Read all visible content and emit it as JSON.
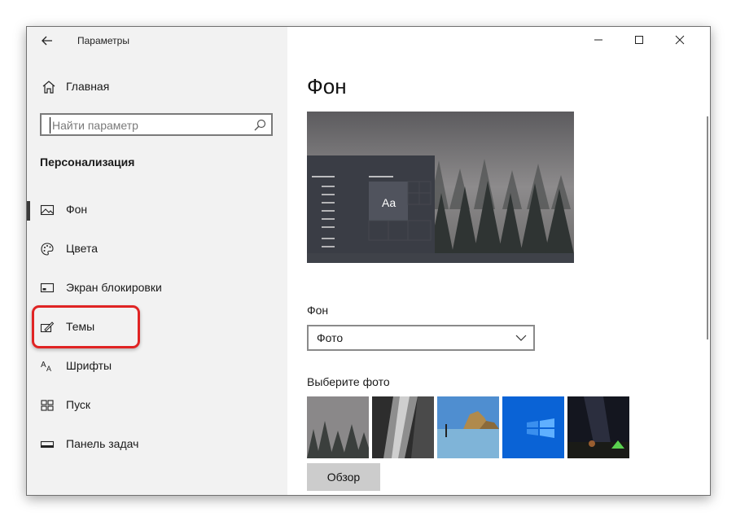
{
  "window": {
    "title": "Параметры",
    "back_icon": "arrow-left-icon",
    "controls": [
      "minimize-icon",
      "maximize-icon",
      "close-icon"
    ]
  },
  "sidebar": {
    "home": {
      "label": "Главная",
      "icon": "home-icon"
    },
    "search": {
      "placeholder": "Найти параметр",
      "value": "",
      "icon": "search-icon"
    },
    "section_title": "Персонализация",
    "items": [
      {
        "label": "Фон",
        "icon": "picture-icon",
        "selected": true
      },
      {
        "label": "Цвета",
        "icon": "palette-icon",
        "selected": false
      },
      {
        "label": "Экран блокировки",
        "icon": "monitor-icon",
        "selected": false
      },
      {
        "label": "Темы",
        "icon": "themes-brush-icon",
        "selected": false,
        "highlighted": true
      },
      {
        "label": "Шрифты",
        "icon": "font-icon",
        "selected": false
      },
      {
        "label": "Пуск",
        "icon": "start-grid-icon",
        "selected": false
      },
      {
        "label": "Панель задач",
        "icon": "taskbar-icon",
        "selected": false
      }
    ],
    "highlight_color": "#e02424"
  },
  "main": {
    "title": "Фон",
    "preview": {
      "sample_text": "Aa"
    },
    "background_label": "Фон",
    "background_dropdown": {
      "value": "Фото"
    },
    "choose_photo_label": "Выберите фото",
    "thumbnails": [
      {
        "name": "foggy-forest"
      },
      {
        "name": "rock-waterfall"
      },
      {
        "name": "beach-rocks"
      },
      {
        "name": "windows-blue"
      },
      {
        "name": "night-sky-tent"
      }
    ],
    "browse_button": "Обзор"
  },
  "colors": {
    "sidebar_bg": "#f2f2f2",
    "main_bg": "#ffffff",
    "accent_highlight": "#e02424",
    "button_bg": "#cccccc"
  }
}
